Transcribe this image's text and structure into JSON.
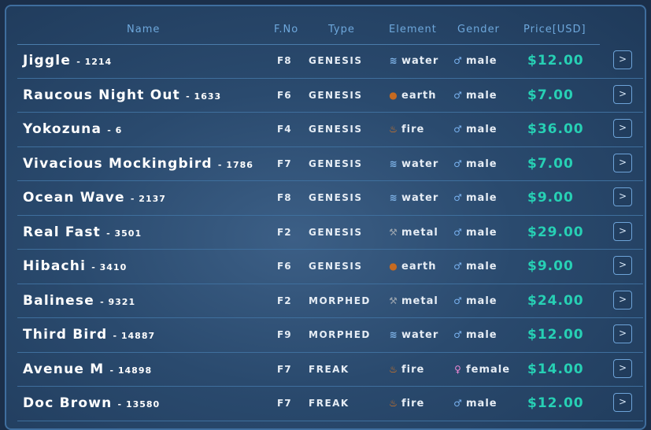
{
  "columns": {
    "name": "Name",
    "fno": "F.No",
    "type": "Type",
    "element": "Element",
    "gender": "Gender",
    "price": "Price[USD]"
  },
  "rows": [
    {
      "name": "Jiggle",
      "id": "- 1214",
      "fno": "F8",
      "type": "GENESIS",
      "element": "water",
      "element_icon": "water-icon",
      "gender": "male",
      "gender_icon": "male-icon",
      "price": "$12.00"
    },
    {
      "name": "Raucous Night Out",
      "id": "- 1633",
      "fno": "F6",
      "type": "GENESIS",
      "element": "earth",
      "element_icon": "earth-icon",
      "gender": "male",
      "gender_icon": "male-icon",
      "price": "$7.00"
    },
    {
      "name": "Yokozuna",
      "id": "- 6",
      "fno": "F4",
      "type": "GENESIS",
      "element": "fire",
      "element_icon": "fire-icon",
      "gender": "male",
      "gender_icon": "male-icon",
      "price": "$36.00"
    },
    {
      "name": "Vivacious Mockingbird",
      "id": "- 1786",
      "fno": "F7",
      "type": "GENESIS",
      "element": "water",
      "element_icon": "water-icon",
      "gender": "male",
      "gender_icon": "male-icon",
      "price": "$7.00"
    },
    {
      "name": "Ocean Wave",
      "id": "- 2137",
      "fno": "F8",
      "type": "GENESIS",
      "element": "water",
      "element_icon": "water-icon",
      "gender": "male",
      "gender_icon": "male-icon",
      "price": "$9.00"
    },
    {
      "name": "Real Fast",
      "id": "- 3501",
      "fno": "F2",
      "type": "GENESIS",
      "element": "metal",
      "element_icon": "hammer-icon",
      "gender": "male",
      "gender_icon": "male-icon",
      "price": "$29.00"
    },
    {
      "name": "Hibachi",
      "id": "- 3410",
      "fno": "F6",
      "type": "GENESIS",
      "element": "earth",
      "element_icon": "earth-icon",
      "gender": "male",
      "gender_icon": "male-icon",
      "price": "$9.00"
    },
    {
      "name": "Balinese",
      "id": "- 9321",
      "fno": "F2",
      "type": "MORPHED",
      "element": "metal",
      "element_icon": "hammer-icon",
      "gender": "male",
      "gender_icon": "male-icon",
      "price": "$24.00"
    },
    {
      "name": "Third Bird",
      "id": "- 14887",
      "fno": "F9",
      "type": "MORPHED",
      "element": "water",
      "element_icon": "water-icon",
      "gender": "male",
      "gender_icon": "male-icon",
      "price": "$12.00"
    },
    {
      "name": "Avenue M",
      "id": "- 14898",
      "fno": "F7",
      "type": "FREAK",
      "element": "fire",
      "element_icon": "fire-icon",
      "gender": "female",
      "gender_icon": "female-icon",
      "price": "$14.00"
    },
    {
      "name": "Doc Brown",
      "id": "- 13580",
      "fno": "F7",
      "type": "FREAK",
      "element": "fire",
      "element_icon": "fire-icon",
      "gender": "male",
      "gender_icon": "male-icon",
      "price": "$12.00"
    }
  ],
  "colors": {
    "accent_price": "#27d0b4",
    "header_text": "#6ea8dc",
    "border": "#3f6e9e"
  }
}
